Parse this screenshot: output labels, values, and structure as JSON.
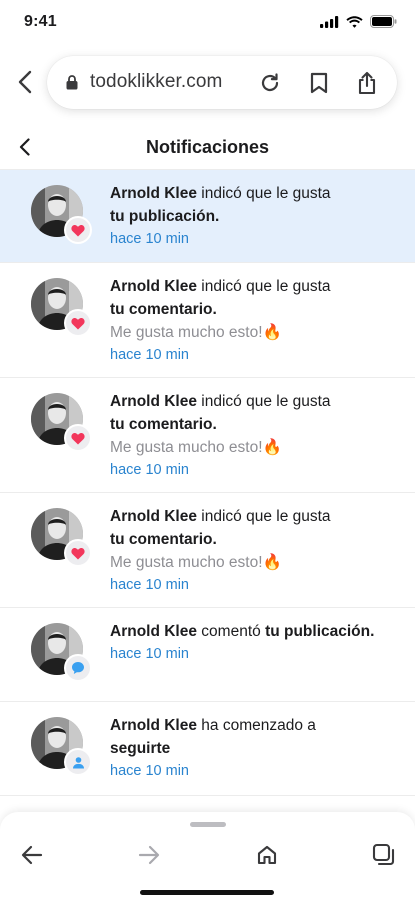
{
  "status_bar": {
    "time": "9:41"
  },
  "browser": {
    "url": "todoklikker.com"
  },
  "header": {
    "title": "Notificaciones"
  },
  "notifications": [
    {
      "name": "Arnold Klee",
      "action": "indicó que le gusta",
      "target": "tu publicación.",
      "comment": "",
      "time": "hace 10 min",
      "badge": "heart",
      "unread": true
    },
    {
      "name": "Arnold Klee",
      "action": "indicó que le gusta",
      "target": "tu comentario.",
      "comment": "Me gusta mucho esto!🔥",
      "time": "hace 10 min",
      "badge": "heart",
      "unread": false
    },
    {
      "name": "Arnold Klee",
      "action": "indicó que le gusta",
      "target": "tu comentario.",
      "comment": "Me gusta mucho esto!🔥",
      "time": "hace 10 min",
      "badge": "heart",
      "unread": false
    },
    {
      "name": "Arnold Klee",
      "action": "indicó que le gusta",
      "target": "tu comentario.",
      "comment": "Me gusta mucho esto!🔥",
      "time": "hace 10 min",
      "badge": "heart",
      "unread": false
    },
    {
      "name": "Arnold Klee",
      "action": "comentó",
      "target": "tu publicación.",
      "comment": "",
      "time": "hace 10 min",
      "badge": "comment",
      "unread": false
    },
    {
      "name": "Arnold Klee",
      "action": "ha comenzado a",
      "target": "seguirte",
      "comment": "",
      "time": "hace 10 min",
      "badge": "user",
      "unread": false
    }
  ],
  "colors": {
    "unread_bg": "#e4effc",
    "time": "#2a84cf",
    "heart": "#f2365b",
    "comment_badge": "#3aa0f0",
    "user_badge": "#3aa0f0"
  },
  "icons": {
    "back": "chevron-left-icon",
    "reload": "reload-icon",
    "bookmark": "bookmark-icon",
    "share": "share-icon",
    "lock": "lock-icon",
    "home": "home-icon",
    "tabs": "tabs-icon"
  }
}
